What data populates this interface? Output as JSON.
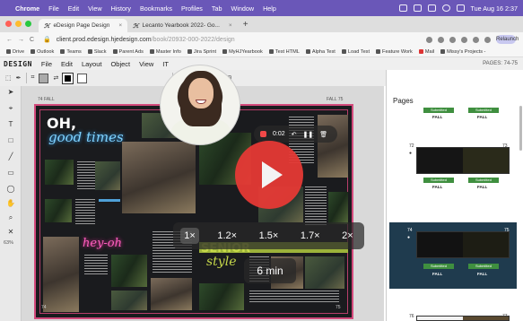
{
  "mac_menubar": {
    "app": "Chrome",
    "menus": [
      "File",
      "Edit",
      "View",
      "History",
      "Bookmarks",
      "Profiles",
      "Tab",
      "Window",
      "Help"
    ],
    "datetime": "Tue Aug 16  2:37"
  },
  "tabs": [
    {
      "label": "eDesign Page Design",
      "active": true
    },
    {
      "label": "Lecanto Yearbook 2022- Go...",
      "active": false
    }
  ],
  "address": {
    "host": "client.prod.edesign.hjedesign.com",
    "path": "/book/20932-000-2022/design",
    "relaunch": "Relaunch"
  },
  "bookmarks": [
    "Drive",
    "Outlook",
    "Teams",
    "Slack",
    "Parent Ads",
    "Master Info",
    "Jira Sprint",
    "MyHJYearbook",
    "Test HTML",
    "Alpha Test",
    "Load Test",
    "Feature Work",
    "Mail",
    "Missy's Projects -"
  ],
  "app_menu": {
    "logo": "DESIGN",
    "menus": [
      "File",
      "Edit",
      "Layout",
      "Object",
      "View",
      "IT"
    ],
    "pages_info": "PAGES: 74-75"
  },
  "canvas": {
    "left_page": "74",
    "right_page": "75",
    "left_label": "FALL",
    "right_label": "FALL",
    "zoom": "63%"
  },
  "yearbook": {
    "oh": "OH,",
    "good_times": "good times",
    "hey_oh": "hey-oh",
    "senior": "SENIOR",
    "style": "style",
    "folio_left": "74",
    "folio_right": "75"
  },
  "recorder": {
    "time": "0:02"
  },
  "playback": {
    "speeds": [
      "1×",
      "1.2×",
      "1.5×",
      "1.7×",
      "2×"
    ],
    "selected_speed": "1×",
    "duration": "6 min"
  },
  "pages_panel": {
    "title": "Pages",
    "cards": [
      {
        "left": "",
        "right": "",
        "status": "Submitted",
        "left_season": "FALL",
        "right_season": "FALL",
        "selected": false
      },
      {
        "left": "72",
        "right": "73",
        "status": "Submitted",
        "left_season": "FALL",
        "right_season": "FALL",
        "selected": false
      },
      {
        "left": "74",
        "right": "75",
        "status": "Submitted",
        "left_season": "FALL",
        "right_season": "FALL",
        "selected": true
      },
      {
        "left": "76",
        "right": "77",
        "status": "",
        "left_season": "",
        "right_season": "",
        "selected": false
      }
    ]
  },
  "colors": {
    "menubar": "#6a57b8",
    "play_button": "#e53935",
    "spread_border": "#d34a7c",
    "selected_card": "#1f3b4e",
    "submitted": "#3f8f3f"
  }
}
